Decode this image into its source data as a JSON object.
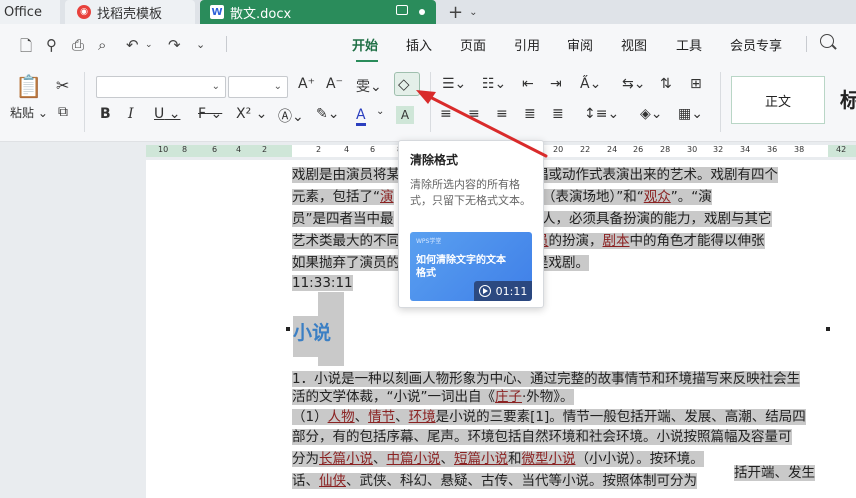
{
  "tabs": {
    "office": "Office",
    "template": "找稻壳模板",
    "document": "散文.docx"
  },
  "menu": [
    "开始",
    "插入",
    "页面",
    "引用",
    "审阅",
    "视图",
    "工具",
    "会员专享"
  ],
  "ribbon": {
    "paste_label": "粘贴",
    "bold": "B",
    "italic": "I",
    "underline": "U",
    "strikethrough": "F",
    "superscript": "X²",
    "style_normal": "正文",
    "style_title": "标"
  },
  "ruler": [
    "10",
    "8",
    "6",
    "4",
    "2",
    "2",
    "4",
    "6",
    "8",
    "10",
    "12",
    "14",
    "16",
    "18",
    "20",
    "22",
    "24",
    "26",
    "28",
    "30",
    "32",
    "34",
    "36",
    "38",
    "42"
  ],
  "tooltip": {
    "title": "清除格式",
    "description": "清除所选内容的所有格式，只留下无格式文本。",
    "video_tag": "WPS学堂",
    "video_title": "如何清除文字的文本格式",
    "duration": "01:11"
  },
  "document": {
    "line1_a": "戏剧是由演员将某",
    "line1_b": "、歌唱或动作式表演出来的艺术。戏剧有四个",
    "line2_a": "元素，包括了“",
    "line2_u1": "演",
    "line2_b": "”、“",
    "line2_u2": "舞台",
    "line2_c": "（表演场地）”和“",
    "line2_u3": "观众",
    "line2_d": "”。“演",
    "line3_a": "员”是四者当中最",
    "line3_b": "的代言人，必须具备扮演的能力，戏剧与其它",
    "line4_a": "艺术类最大的不同",
    "line4_b": "过",
    "line4_u1": "演员",
    "line4_c": "的扮演，",
    "line4_u2": "剧本",
    "line4_d": "中的角色才能得以伸张",
    "line5_a": "如果抛弃了演员的",
    "line5_b": "不再是戏剧。",
    "time": "11:33:11",
    "heading": "小说",
    "p1_l1": "1．小说是一种以刻画人物形象为中心、通过完整的故事情节和环境描写来反映社会生",
    "p1_l2": "活的文学体裁，“小说”一词出自《",
    "p1_u": "庄子",
    "p1_l2b": "·外物》。",
    "p2_a": "（1）",
    "p2_u1": "人物",
    "p2_u2": "情节",
    "p2_u3": "环境",
    "p2_b": "是小说的三要素[1]。情节一般包括开端、发展、高潮、结局四",
    "p3": "部分，有的包括序幕、尾声。环境包括自然环境和社会环境。小说按照篇幅及容量可",
    "p4_a": "分为",
    "p4_u1": "长篇小说",
    "p4_u2": "中篇小说",
    "p4_u3": "短篇小说",
    "p4_b": "和",
    "p4_u4": "微型小说",
    "p4_c": "（小小说）。按环境。",
    "p5_a": "话、",
    "p5_u1": "仙侠",
    "p5_b": "、武侠、科幻、悬疑、古传、当代等小说。按照体制可分为",
    "p5_c": "括开端、发生"
  }
}
